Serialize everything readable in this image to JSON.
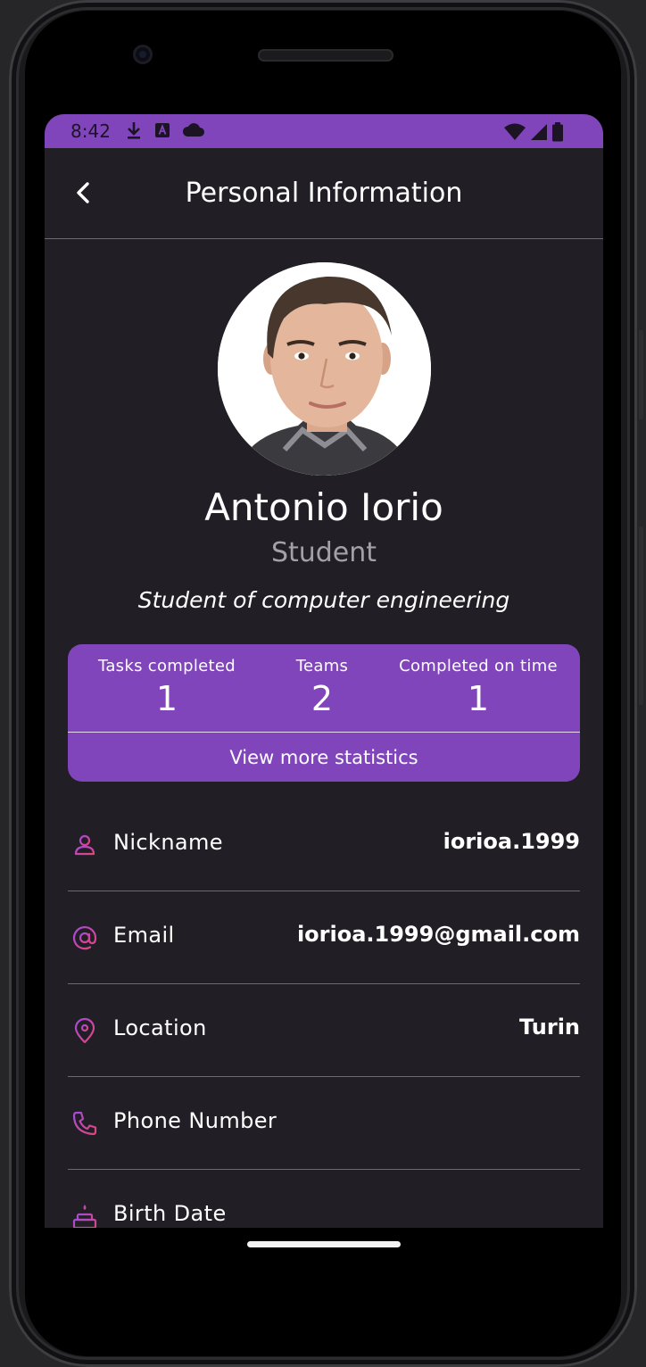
{
  "status_bar": {
    "time": "8:42",
    "left_icons": [
      "download-icon",
      "a-badge-icon",
      "cloud-icon"
    ],
    "right_icons": [
      "wifi-icon",
      "signal-icon",
      "battery-icon"
    ]
  },
  "app_bar": {
    "title": "Personal Information",
    "back_icon": "chevron-left-icon"
  },
  "profile": {
    "name": "Antonio Iorio",
    "role": "Student",
    "bio": "Student of computer engineering"
  },
  "stats": {
    "items": [
      {
        "label": "Tasks completed",
        "value": "1"
      },
      {
        "label": "Teams",
        "value": "2"
      },
      {
        "label": "Completed on time",
        "value": "1"
      }
    ],
    "more_label": "View more statistics"
  },
  "info_rows": [
    {
      "icon": "person-icon",
      "label": "Nickname",
      "value": "iorioa.1999"
    },
    {
      "icon": "at-sign-icon",
      "label": "Email",
      "value": "iorioa.1999@gmail.com"
    },
    {
      "icon": "location-pin-icon",
      "label": "Location",
      "value": "Turin"
    },
    {
      "icon": "phone-icon",
      "label": "Phone Number",
      "value": ""
    },
    {
      "icon": "cake-icon",
      "label": "Birth Date",
      "value": ""
    }
  ],
  "colors": {
    "accent": "#8045bb",
    "background": "#211f25",
    "icon_gradient_start": "#a64ad9",
    "icon_gradient_end": "#e2457a"
  }
}
